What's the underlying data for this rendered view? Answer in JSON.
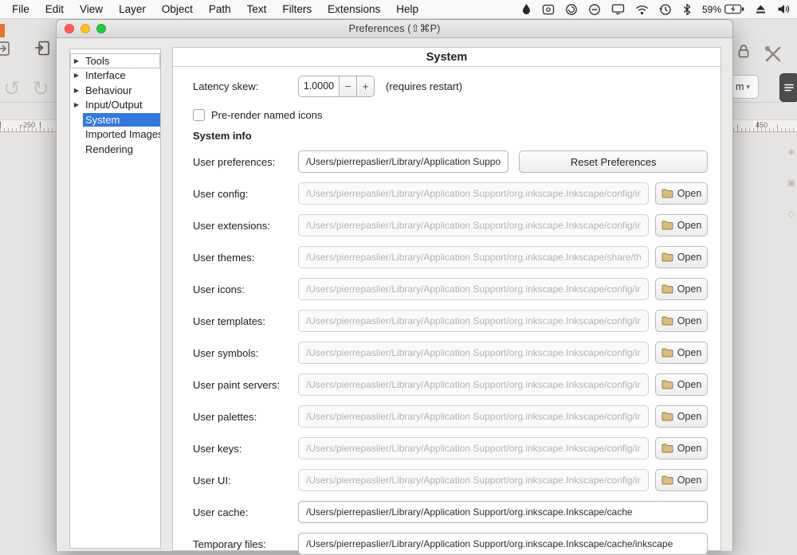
{
  "menubar": {
    "items": [
      "File",
      "Edit",
      "View",
      "Layer",
      "Object",
      "Path",
      "Text",
      "Filters",
      "Extensions",
      "Help"
    ],
    "battery": "59%"
  },
  "window": {
    "title": "Preferences (⇧⌘P)"
  },
  "sidebar": {
    "items": [
      {
        "label": "Tools",
        "expandable": true,
        "focused": true
      },
      {
        "label": "Interface",
        "expandable": true
      },
      {
        "label": "Behaviour",
        "expandable": true
      },
      {
        "label": "Input/Output",
        "expandable": true
      },
      {
        "label": "System",
        "selected": true
      },
      {
        "label": "Imported Images"
      },
      {
        "label": "Rendering"
      }
    ]
  },
  "panel": {
    "title": "System",
    "latency": {
      "label": "Latency skew:",
      "value": "1.0000",
      "minus": "−",
      "plus": "+",
      "note": "(requires restart)"
    },
    "checkbox": {
      "label": "Pre-render named icons",
      "checked": false
    },
    "section_title": "System info",
    "rows": [
      {
        "label": "User preferences:",
        "value": "/Users/pierrepaslier/Library/Application Support",
        "state": "editable",
        "size": "short",
        "button": "Reset Preferences",
        "button_type": "reset"
      },
      {
        "label": "User config:",
        "value": "/Users/pierrepaslier/Library/Application Support/org.inkscape.Inkscape/config/inl",
        "state": "disabled",
        "size": "normal",
        "button": "Open",
        "button_type": "open"
      },
      {
        "label": "User extensions:",
        "value": "/Users/pierrepaslier/Library/Application Support/org.inkscape.Inkscape/config/inl",
        "state": "disabled",
        "size": "normal",
        "button": "Open",
        "button_type": "open"
      },
      {
        "label": "User themes:",
        "value": "/Users/pierrepaslier/Library/Application Support/org.inkscape.Inkscape/share/the",
        "state": "disabled",
        "size": "normal",
        "button": "Open",
        "button_type": "open"
      },
      {
        "label": "User icons:",
        "value": "/Users/pierrepaslier/Library/Application Support/org.inkscape.Inkscape/config/inl",
        "state": "disabled",
        "size": "normal",
        "button": "Open",
        "button_type": "open"
      },
      {
        "label": "User templates:",
        "value": "/Users/pierrepaslier/Library/Application Support/org.inkscape.Inkscape/config/inl",
        "state": "disabled",
        "size": "normal",
        "button": "Open",
        "button_type": "open"
      },
      {
        "label": "User symbols:",
        "value": "/Users/pierrepaslier/Library/Application Support/org.inkscape.Inkscape/config/inl",
        "state": "disabled",
        "size": "normal",
        "button": "Open",
        "button_type": "open"
      },
      {
        "label": "User paint servers:",
        "value": "/Users/pierrepaslier/Library/Application Support/org.inkscape.Inkscape/config/inl",
        "state": "disabled",
        "size": "normal",
        "button": "Open",
        "button_type": "open"
      },
      {
        "label": "User palettes:",
        "value": "/Users/pierrepaslier/Library/Application Support/org.inkscape.Inkscape/config/inl",
        "state": "disabled",
        "size": "normal",
        "button": "Open",
        "button_type": "open"
      },
      {
        "label": "User keys:",
        "value": "/Users/pierrepaslier/Library/Application Support/org.inkscape.Inkscape/config/inl",
        "state": "disabled",
        "size": "normal",
        "button": "Open",
        "button_type": "open"
      },
      {
        "label": "User UI:",
        "value": "/Users/pierrepaslier/Library/Application Support/org.inkscape.Inkscape/config/inl",
        "state": "disabled",
        "size": "normal",
        "button": "Open",
        "button_type": "open"
      },
      {
        "label": "User cache:",
        "value": "/Users/pierrepaslier/Library/Application Support/org.inkscape.Inkscape/cache",
        "state": "editable",
        "size": "wide"
      },
      {
        "label": "Temporary files:",
        "value": "/Users/pierrepaslier/Library/Application Support/org.inkscape.Inkscape/cache/inkscape",
        "state": "editable",
        "size": "wide"
      }
    ]
  },
  "background": {
    "ruler_left_number": "-250",
    "ruler_right_number": "450",
    "unit_dropdown": "m",
    "unit_caret": "▾"
  }
}
